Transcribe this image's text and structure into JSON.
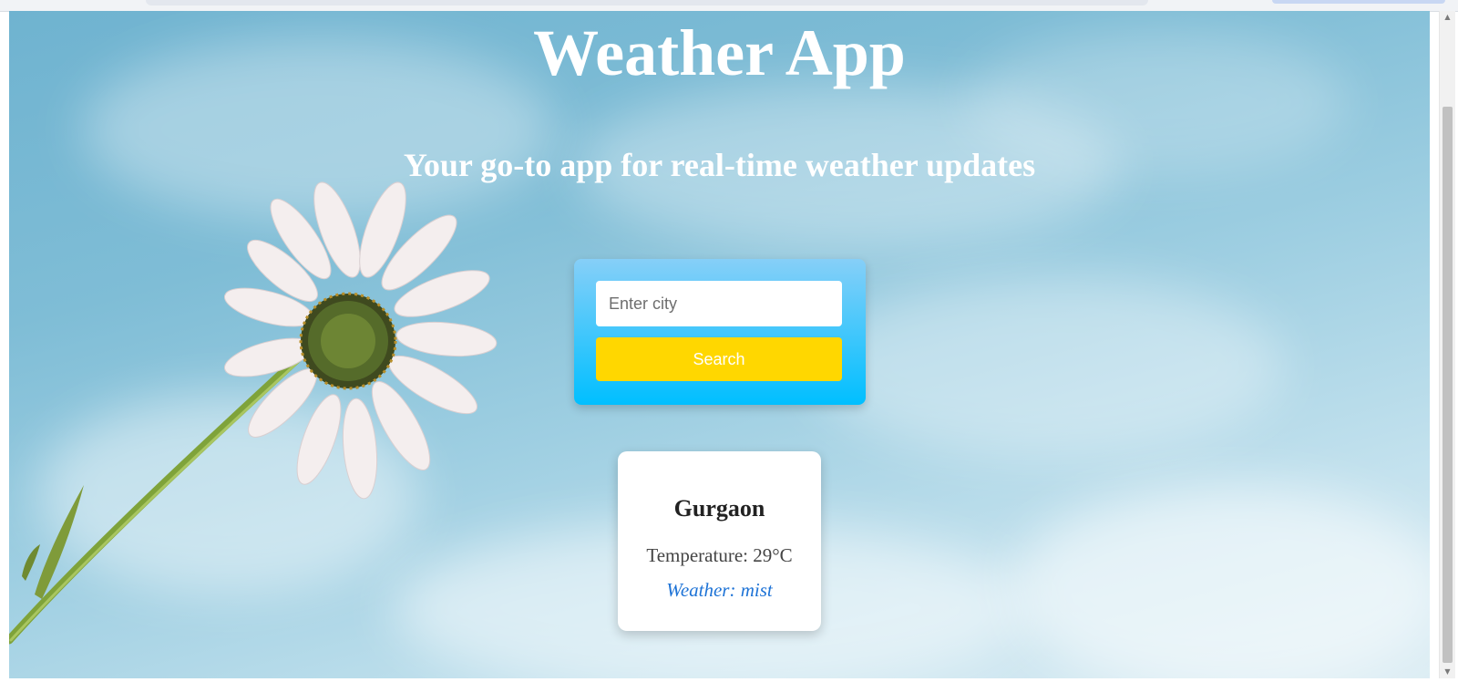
{
  "app": {
    "title": "Weather App",
    "tagline": "Your go-to app for real-time weather updates"
  },
  "search": {
    "placeholder": "Enter city",
    "value": "",
    "button_label": "Search"
  },
  "result": {
    "city": "Gurgaon",
    "temperature_text": "Temperature: 29°C",
    "weather_text": "Weather: mist"
  },
  "colors": {
    "panel_gradient_top": "#86cff8",
    "panel_gradient_bottom": "#00bfff",
    "search_button": "#ffd700",
    "weather_text": "#1e73d6",
    "heading_text": "#ffffff"
  },
  "icons": {
    "background": "sky-daisy-photo",
    "scroll_up": "scroll-up-arrow-icon",
    "scroll_down": "scroll-down-arrow-icon"
  }
}
